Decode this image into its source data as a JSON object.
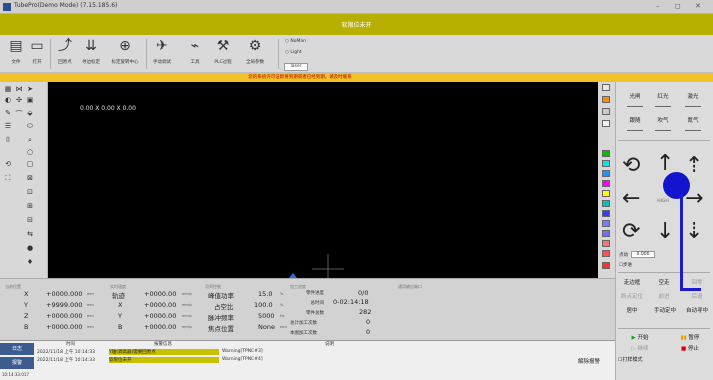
{
  "titlebar": {
    "title": "TubePro(Demo Mode) (7.15.185.6)",
    "min": "–",
    "max": "◻",
    "close": "✕"
  },
  "banner": {
    "text": "软限位未开"
  },
  "toolbar": {
    "items": [
      {
        "label": "文件",
        "icon": "file-icon",
        "glyph": "▤"
      },
      {
        "label": "打开",
        "icon": "open-icon",
        "glyph": "▭"
      },
      {
        "label": "回原点",
        "icon": "home-icon",
        "glyph": "⤴"
      },
      {
        "label": "寻边标定",
        "icon": "edge-find-icon",
        "glyph": "⇊"
      },
      {
        "label": "标定旋转中心",
        "icon": "rotate-center-icon",
        "glyph": "⊕"
      },
      {
        "label": "手动调试",
        "icon": "manual-debug-icon",
        "glyph": "✈"
      },
      {
        "label": "工具",
        "icon": "tools-icon",
        "glyph": "⌁"
      },
      {
        "label": "PLC过程",
        "icon": "plc-icon",
        "glyph": "⚒"
      },
      {
        "label": "全局参数",
        "icon": "settings-icon",
        "glyph": "⚙"
      }
    ],
    "radio1": "○ NoMan",
    "radio2": "○ Light",
    "laser_button": "laser"
  },
  "warning": {
    "text": "您的系统许可证即将到期或者已经到期，请及时联系"
  },
  "canvas": {
    "coord_text": "0.00 X 0.00 X 0.00"
  },
  "colors": {
    "accent_banner": "#b8b000",
    "canvas": "#000000",
    "alarm_yellow": "#c8c000",
    "overlay_blue": "#1414cf"
  },
  "swatches": [
    "#e8e8e8",
    "#ff8c00",
    "#cccccc",
    "#f0f0f0",
    "#00c000",
    "#00e5e5",
    "#1e90ff",
    "#ff00ff",
    "#ffff00",
    "#00c0c0",
    "#3a3aff",
    "#7a7aff",
    "#7070ff",
    "#ff7070",
    "#ff5050",
    "#ff3030"
  ],
  "right": {
    "row1": [
      "光闸",
      "红光",
      "激光"
    ],
    "row2": [
      "跟随",
      "吹气",
      "氮气"
    ],
    "high_label": "HIGH",
    "step_label": "步进",
    "step_value": "0.000",
    "point_label": "点动",
    "row3": [
      "走边框",
      "空走",
      "回零"
    ],
    "row4": [
      "断点定位",
      "前进",
      "后退"
    ],
    "row5": [
      "居中",
      "手动定中",
      "自动寻中"
    ],
    "start": "开始",
    "pause": "暂停",
    "resume": "继续",
    "stop": "停止",
    "empty_mode": "打样模式"
  },
  "info": {
    "sec1": "当前位置",
    "sec2": "实时速度",
    "sec3": "功率控制",
    "sec4": "加工进度",
    "sec5": "通用输出端口",
    "axes": [
      {
        "name": "X",
        "val": "+0000.000",
        "unit": "mm"
      },
      {
        "name": "Y",
        "val": "+9999.000",
        "unit": "mm"
      },
      {
        "name": "Z",
        "val": "+0000.000",
        "unit": "mm"
      },
      {
        "name": "B",
        "val": "+0000.000",
        "unit": "mm"
      }
    ],
    "speeds": [
      {
        "name": "轨迹",
        "val": "+0000.00",
        "unit": "mm/s"
      },
      {
        "name": "X",
        "val": "+0000.00",
        "unit": "mm/s"
      },
      {
        "name": "Y",
        "val": "+0000.00",
        "unit": "mm/s"
      },
      {
        "name": "B",
        "val": "+0000.00",
        "unit": "mm/s"
      }
    ],
    "power": [
      {
        "name": "峰值功率",
        "val": "15.0",
        "unit": "%"
      },
      {
        "name": "占空比",
        "val": "100.0",
        "unit": "%"
      },
      {
        "name": "脉冲频率",
        "val": "5000",
        "unit": "Hz"
      },
      {
        "name": "焦点位置",
        "val": "None",
        "unit": "mm"
      }
    ],
    "progress": [
      {
        "name": "零件进度",
        "val": "0/0"
      },
      {
        "name": "总时间",
        "val": "0-02:14:18"
      },
      {
        "name": "零件总数",
        "val": "282"
      },
      {
        "name": "总计加工次数",
        "val": "0"
      },
      {
        "name": "本图加工次数",
        "val": "0"
      }
    ]
  },
  "alarm": {
    "log_btn": "日志",
    "alarm_btn": "报警",
    "col_time": "时间",
    "col_info": "报警信息",
    "col_desc": "说明",
    "rows": [
      {
        "time": "2022/11/18 上午 10:14:33",
        "info": "Y轴(调高器)需要回原点",
        "desc": "Warning[TPNC#3]"
      },
      {
        "time": "2022/11/18 上午 10:14:33",
        "info": "软限位未开",
        "desc": "Warning[TPNC#4]"
      }
    ],
    "ack": "解除报警",
    "timestamp": "10:14:33:017"
  }
}
